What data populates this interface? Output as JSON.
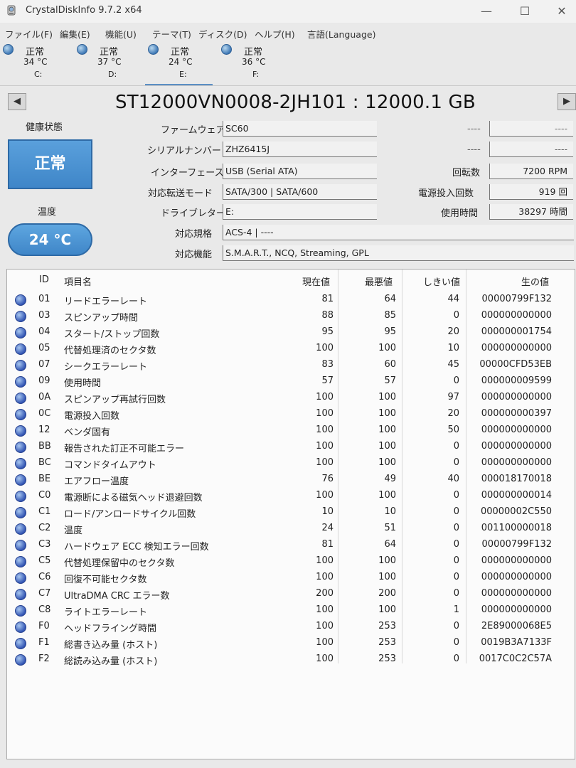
{
  "window": {
    "title": "CrystalDiskInfo 9.7.2 x64",
    "minimize_glyph": "—",
    "maximize_glyph": "☐",
    "close_glyph": "✕"
  },
  "menu": [
    "ファイル(F)",
    "編集(E)",
    "機能(U)",
    "テーマ(T)",
    "ディスク(D)",
    "ヘルプ(H)",
    "言語(Language)"
  ],
  "drives": [
    {
      "status": "正常",
      "temp": "34 °C",
      "letter": "C:"
    },
    {
      "status": "正常",
      "temp": "37 °C",
      "letter": "D:"
    },
    {
      "status": "正常",
      "temp": "24 °C",
      "letter": "E:"
    },
    {
      "status": "正常",
      "temp": "36 °C",
      "letter": "F:"
    }
  ],
  "nav": {
    "prev": "◀",
    "next": "▶"
  },
  "disk": {
    "model": "ST12000VN0008-2JH101 : 12000.1 GB",
    "health_label": "健康状態",
    "health_status": "正常",
    "temp_label": "温度",
    "temperature": "24 °C",
    "firmware_label": "ファームウェア",
    "firmware": "SC60",
    "serial_label": "シリアルナンバー",
    "serial": "ZHZ6415J",
    "interface_label": "インターフェース",
    "interface": "USB (Serial ATA)",
    "transfer_label": "対応転送モード",
    "transfer": "SATA/300 | SATA/600",
    "drive_letter_label": "ドライブレター",
    "drive_letter": "E:",
    "standard_label": "対応規格",
    "standard": "ACS-4 | ----",
    "features_label": "対応機能",
    "features": "S.M.A.R.T., NCQ, Streaming, GPL",
    "blank1_label": "----",
    "blank1_value": "----",
    "blank2_label": "----",
    "blank2_value": "----",
    "rotation_label": "回転数",
    "rotation": "7200 RPM",
    "power_count_label": "電源投入回数",
    "power_count": "919 回",
    "power_hours_label": "使用時間",
    "power_hours": "38297 時間"
  },
  "smart": {
    "headers": {
      "id": "ID",
      "name": "項目名",
      "current": "現在値",
      "worst": "最悪値",
      "threshold": "しきい値",
      "raw": "生の値"
    },
    "rows": [
      {
        "id": "01",
        "name": "リードエラーレート",
        "current": "81",
        "worst": "64",
        "threshold": "44",
        "raw": "00000799F132"
      },
      {
        "id": "03",
        "name": "スピンアップ時間",
        "current": "88",
        "worst": "85",
        "threshold": "0",
        "raw": "000000000000"
      },
      {
        "id": "04",
        "name": "スタート/ストップ回数",
        "current": "95",
        "worst": "95",
        "threshold": "20",
        "raw": "000000001754"
      },
      {
        "id": "05",
        "name": "代替処理済のセクタ数",
        "current": "100",
        "worst": "100",
        "threshold": "10",
        "raw": "000000000000"
      },
      {
        "id": "07",
        "name": "シークエラーレート",
        "current": "83",
        "worst": "60",
        "threshold": "45",
        "raw": "00000CFD53EB"
      },
      {
        "id": "09",
        "name": "使用時間",
        "current": "57",
        "worst": "57",
        "threshold": "0",
        "raw": "000000009599"
      },
      {
        "id": "0A",
        "name": "スピンアップ再試行回数",
        "current": "100",
        "worst": "100",
        "threshold": "97",
        "raw": "000000000000"
      },
      {
        "id": "0C",
        "name": "電源投入回数",
        "current": "100",
        "worst": "100",
        "threshold": "20",
        "raw": "000000000397"
      },
      {
        "id": "12",
        "name": "ベンダ固有",
        "current": "100",
        "worst": "100",
        "threshold": "50",
        "raw": "000000000000"
      },
      {
        "id": "BB",
        "name": "報告された訂正不可能エラー",
        "current": "100",
        "worst": "100",
        "threshold": "0",
        "raw": "000000000000"
      },
      {
        "id": "BC",
        "name": "コマンドタイムアウト",
        "current": "100",
        "worst": "100",
        "threshold": "0",
        "raw": "000000000000"
      },
      {
        "id": "BE",
        "name": "エアフロー温度",
        "current": "76",
        "worst": "49",
        "threshold": "40",
        "raw": "000018170018"
      },
      {
        "id": "C0",
        "name": "電源断による磁気ヘッド退避回数",
        "current": "100",
        "worst": "100",
        "threshold": "0",
        "raw": "000000000014"
      },
      {
        "id": "C1",
        "name": "ロード/アンロードサイクル回数",
        "current": "10",
        "worst": "10",
        "threshold": "0",
        "raw": "00000002C550"
      },
      {
        "id": "C2",
        "name": "温度",
        "current": "24",
        "worst": "51",
        "threshold": "0",
        "raw": "001100000018"
      },
      {
        "id": "C3",
        "name": "ハードウェア ECC 検知エラー回数",
        "current": "81",
        "worst": "64",
        "threshold": "0",
        "raw": "00000799F132"
      },
      {
        "id": "C5",
        "name": "代替処理保留中のセクタ数",
        "current": "100",
        "worst": "100",
        "threshold": "0",
        "raw": "000000000000"
      },
      {
        "id": "C6",
        "name": "回復不可能セクタ数",
        "current": "100",
        "worst": "100",
        "threshold": "0",
        "raw": "000000000000"
      },
      {
        "id": "C7",
        "name": "UltraDMA CRC エラー数",
        "current": "200",
        "worst": "200",
        "threshold": "0",
        "raw": "000000000000"
      },
      {
        "id": "C8",
        "name": "ライトエラーレート",
        "current": "100",
        "worst": "100",
        "threshold": "1",
        "raw": "000000000000"
      },
      {
        "id": "F0",
        "name": "ヘッドフライング時間",
        "current": "100",
        "worst": "253",
        "threshold": "0",
        "raw": "2E89000068E5"
      },
      {
        "id": "F1",
        "name": "総書き込み量 (ホスト)",
        "current": "100",
        "worst": "253",
        "threshold": "0",
        "raw": "0019B3A7133F"
      },
      {
        "id": "F2",
        "name": "総読み込み量 (ホスト)",
        "current": "100",
        "worst": "253",
        "threshold": "0",
        "raw": "0017C0C2C57A"
      }
    ]
  }
}
